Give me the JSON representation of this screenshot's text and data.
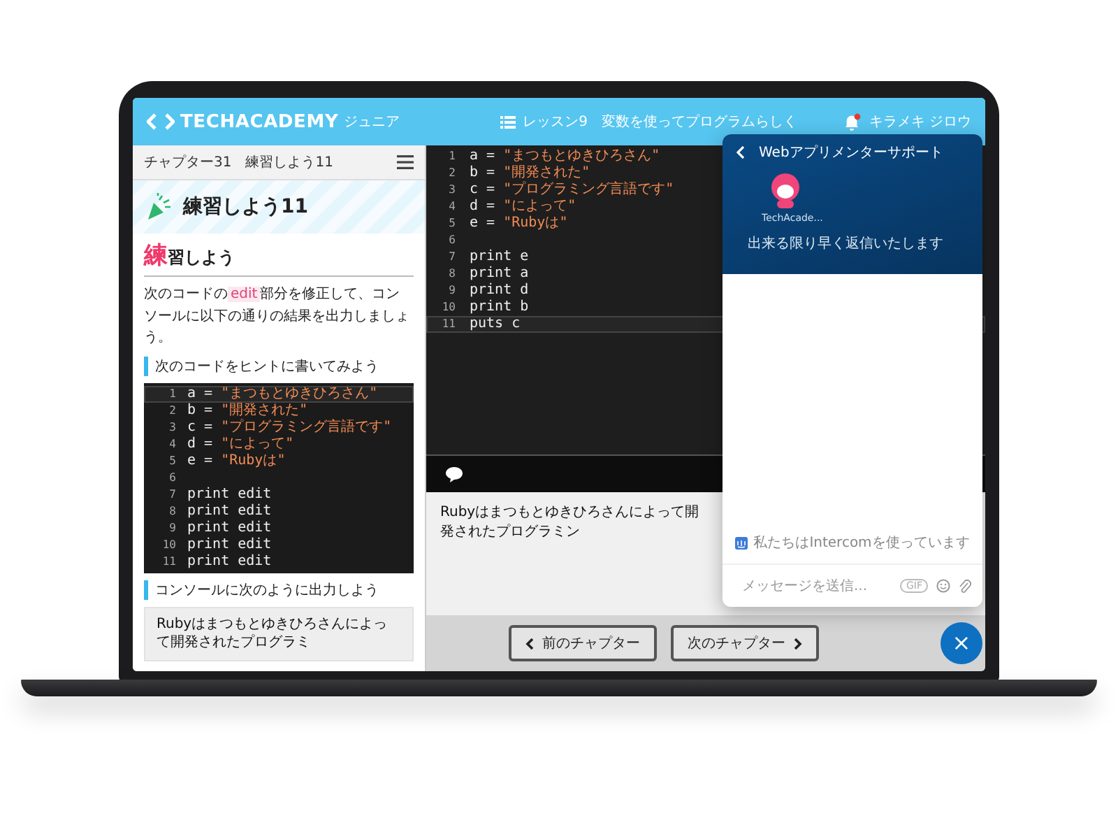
{
  "header": {
    "logo": "TECHACADEMY",
    "logo_sub": "ジュニア",
    "lesson": "レッスン9　変数を使ってプログラムらしく",
    "user": "キラメキ ジロウ"
  },
  "sidebar": {
    "breadcrumb": "チャプター31　練習しよう11",
    "title": "練習しよう11",
    "heading": "**練**習しよう",
    "instruction": [
      {
        "kind": "text",
        "text": "次のコードの"
      },
      {
        "kind": "code",
        "text": "edit"
      },
      {
        "kind": "text",
        "text": "部分を修正して、コンソールに以下の通りの結果を出力しましょう。"
      }
    ],
    "hint_heading": "次のコードをヒントに書いてみよう",
    "hint_code": [
      {
        "num": "1",
        "code": "a = ",
        "string": "\"まつもとゆきひろさん\"",
        "active": true
      },
      {
        "num": "2",
        "code": "b = ",
        "string": "\"開発された\"",
        "active": false
      },
      {
        "num": "3",
        "code": "c = ",
        "string": "\"プログラミング言語です\"",
        "active": false
      },
      {
        "num": "4",
        "code": "d = ",
        "string": "\"によって\"",
        "active": false
      },
      {
        "num": "5",
        "code": "e = ",
        "string": "\"Rubyは\"",
        "active": false
      },
      {
        "num": "6",
        "active": false
      },
      {
        "num": "7",
        "code": "print edit",
        "active": false
      },
      {
        "num": "8",
        "code": "print edit",
        "active": false
      },
      {
        "num": "9",
        "code": "print edit",
        "active": false
      },
      {
        "num": "10",
        "code": "print edit",
        "active": false
      },
      {
        "num": "11",
        "code": "print edit",
        "active": false
      }
    ],
    "output_heading": "コンソールに次のように出力しよう",
    "output": "Rubyはまつもとゆきひろさんによって開発されたプログラミ"
  },
  "editor": {
    "lines": [
      {
        "num": "1",
        "code": "a = ",
        "string": "\"まつもとゆきひろさん\"",
        "active": false
      },
      {
        "num": "2",
        "code": "b = ",
        "string": "\"開発された\"",
        "active": false
      },
      {
        "num": "3",
        "code": "c = ",
        "string": "\"プログラミング言語です\"",
        "active": false
      },
      {
        "num": "4",
        "code": "d = ",
        "string": "\"によって\"",
        "active": false
      },
      {
        "num": "5",
        "code": "e = ",
        "string": "\"Rubyは\"",
        "active": false
      },
      {
        "num": "6",
        "active": false
      },
      {
        "num": "7",
        "code": "print e",
        "active": false
      },
      {
        "num": "8",
        "code": "print a",
        "active": false
      },
      {
        "num": "9",
        "code": "print d",
        "active": false
      },
      {
        "num": "10",
        "code": "print b",
        "active": false
      },
      {
        "num": "11",
        "code": "puts c",
        "active": true
      }
    ],
    "console_output": "Rubyはまつもとゆきひろさんによって開発されたプログラミン"
  },
  "nav": {
    "prev": "前のチャプター",
    "next": "次のチャプター"
  },
  "chat": {
    "title": "Webアプリメンターサポート",
    "team": "TechAcade...",
    "reply_time": "出来る限り早く返信いたします",
    "powered_by": "私たちはIntercomを使っています",
    "placeholder": "メッセージを送信...",
    "gif": "GIF",
    "close": "×"
  }
}
